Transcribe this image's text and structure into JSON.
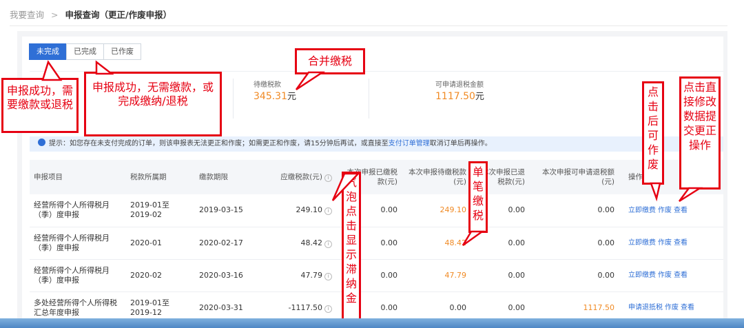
{
  "breadcrumb": {
    "parent": "我要查询",
    "separator": ">",
    "current": "申报查询（更正/作废申报）"
  },
  "tabs": [
    {
      "label": "未完成",
      "active": true
    },
    {
      "label": "已完成",
      "active": false
    },
    {
      "label": "已作废",
      "active": false
    }
  ],
  "summary": {
    "pending_label": "待缴税款",
    "pending_value": "345.31",
    "pending_unit": "元",
    "refund_label": "可申请退税金额",
    "refund_value": "1117.50",
    "refund_unit": "元"
  },
  "tip": {
    "prefix": "提示：如您存在未支付完成的订单，则该申报表无法更正和作废；如需更正和作废，请15分钟后再试，或直接至",
    "link": "支付订单管理",
    "suffix": "取消订单后再操作。"
  },
  "table": {
    "headers": [
      "申报项目",
      "税款所属期",
      "缴款期限",
      "应缴税款(元)",
      "本次申报已缴税款(元)",
      "本次申报待缴税款(元)",
      "本次申报已退税款(元)",
      "本次申报可申请退税额(元)",
      "操作"
    ],
    "rows": [
      {
        "item": "经营所得个人所得税月（季）度申报",
        "period": "2019-01至2019-02",
        "deadline": "2019-03-15",
        "due": "249.10",
        "paid": "0.00",
        "pending": "249.10",
        "refunded": "0.00",
        "refundable": "0.00",
        "actions": [
          "立即缴费",
          "作废",
          "查看"
        ]
      },
      {
        "item": "经营所得个人所得税月（季）度申报",
        "period": "2020-01",
        "deadline": "2020-02-17",
        "due": "48.42",
        "paid": "0.00",
        "pending": "48.42",
        "refunded": "0.00",
        "refundable": "0.00",
        "actions": [
          "立即缴费",
          "作废",
          "查看"
        ]
      },
      {
        "item": "经营所得个人所得税月（季）度申报",
        "period": "2020-02",
        "deadline": "2020-03-16",
        "due": "47.79",
        "paid": "0.00",
        "pending": "47.79",
        "refunded": "0.00",
        "refundable": "0.00",
        "actions": [
          "立即缴费",
          "作废",
          "查看"
        ]
      },
      {
        "item": "多处经营所得个人所得税汇总年度申报",
        "period": "2019-01至2019-12",
        "deadline": "2020-03-31",
        "due": "-1117.50",
        "paid": "0.00",
        "pending": "0.00",
        "refunded": "0.00",
        "refundable": "1117.50",
        "actions": [
          "申请退抵税",
          "作废",
          "查看"
        ]
      }
    ]
  },
  "annotations": {
    "need_pay": "申报成功，需要缴款或退税",
    "no_need": "申报成功，无需缴款，或完成缴纳/退税",
    "merge": "合并缴税",
    "bubble": "气泡点击显示滞纳金",
    "single": "单笔缴税",
    "void": "点击后可作废",
    "modify": "点击直接修改数据提交更正操作"
  },
  "colors": {
    "accent": "#2f6fd6",
    "orange": "#f08a24",
    "annotation": "#e60012"
  }
}
